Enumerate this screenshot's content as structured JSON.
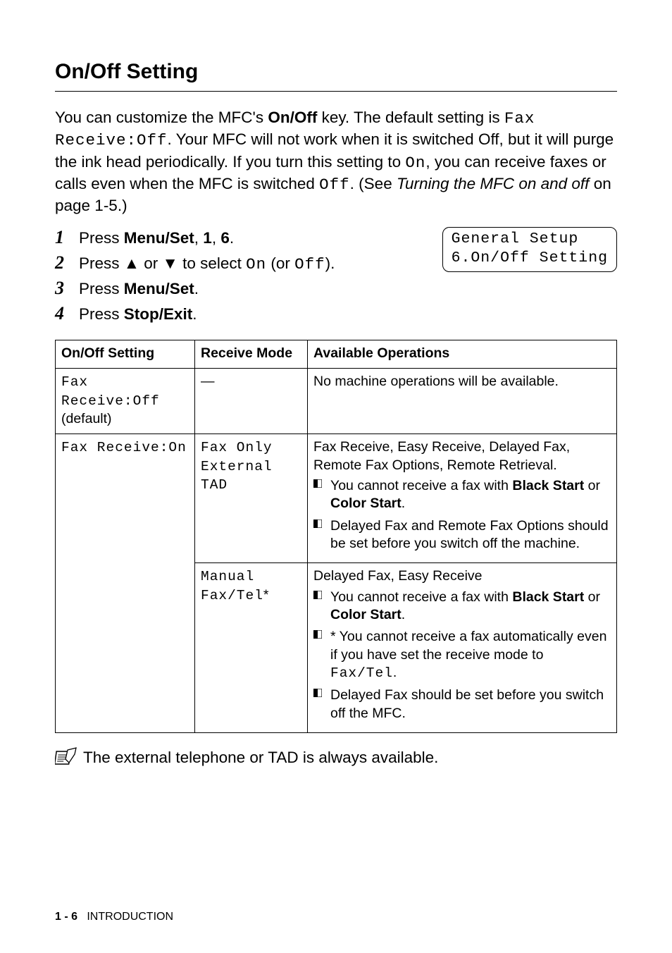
{
  "section_title": "On/Off Setting",
  "para_parts": {
    "p1": "You can customize the MFC's ",
    "p2": " key. The default setting is ",
    "mono1": "Fax Receive:Off",
    "p3": ". Your MFC will not work when it is switched Off, but it will purge the ink head periodically. If you turn this setting to ",
    "mono2": "On",
    "p4": ", you can receive faxes or calls even when the MFC is switched ",
    "mono3": "Off",
    "p5": ". (See ",
    "xref": "Turning the MFC on and off",
    "p6": " on page 1-5.)",
    "onoff_bold": "On/Off"
  },
  "steps": [
    {
      "num": "1",
      "pre": "Press ",
      "bold": "Menu/Set",
      "mid": ", ",
      "bold2": "1",
      "mid2": ", ",
      "bold3": "6",
      "post": "."
    },
    {
      "num": "2",
      "pre": "Press ▲ or ▼ to select ",
      "mono": "On",
      "mid": " (or ",
      "mono2": "Off",
      "post": ")."
    },
    {
      "num": "3",
      "pre": "Press ",
      "bold": "Menu/Set",
      "post": "."
    },
    {
      "num": "4",
      "pre": "Press ",
      "bold": "Stop/Exit",
      "post": "."
    }
  ],
  "lcd": {
    "line1": "General Setup",
    "line2": "6.On/Off Setting"
  },
  "table_headers": {
    "c1": "On/Off Setting",
    "c2": "Receive Mode",
    "c3": "Available Operations"
  },
  "row1": {
    "setting_mono": "Fax Receive:Off",
    "setting_plain": "(default)",
    "mode": "—",
    "ops_intro": "No machine operations will be available."
  },
  "row2": {
    "setting_mono": "Fax Receive:On",
    "mode_line1": "Fax Only",
    "mode_line2": "External TAD",
    "ops_intro": "Fax Receive, Easy Receive, Delayed Fax, Remote Fax Options, Remote Retrieval.",
    "b1_pre": "You cannot receive a fax with ",
    "b1_bold1": "Black Start",
    "b1_mid": " or ",
    "b1_bold2": "Color Start",
    "b1_post": ".",
    "b2": "Delayed Fax and Remote Fax Options should be set before you switch off the machine."
  },
  "row3": {
    "mode_line1": "Manual",
    "mode_line2_pre": "Fax/Tel",
    "mode_line2_post": "*",
    "ops_intro": "Delayed Fax, Easy Receive",
    "b1_pre": "You cannot receive a fax with ",
    "b1_bold1": "Black Start",
    "b1_mid": " or ",
    "b1_bold2": "Color Start",
    "b1_post": ".",
    "b2_pre": "* You cannot receive a fax automatically even if you have set the receive mode to ",
    "b2_mono": "Fax/Tel",
    "b2_post": ".",
    "b3": "Delayed Fax should be set before you switch off the MFC."
  },
  "note": "The external telephone or TAD is always available.",
  "footer": {
    "page": "1 - 6",
    "chapter": "INTRODUCTION"
  }
}
